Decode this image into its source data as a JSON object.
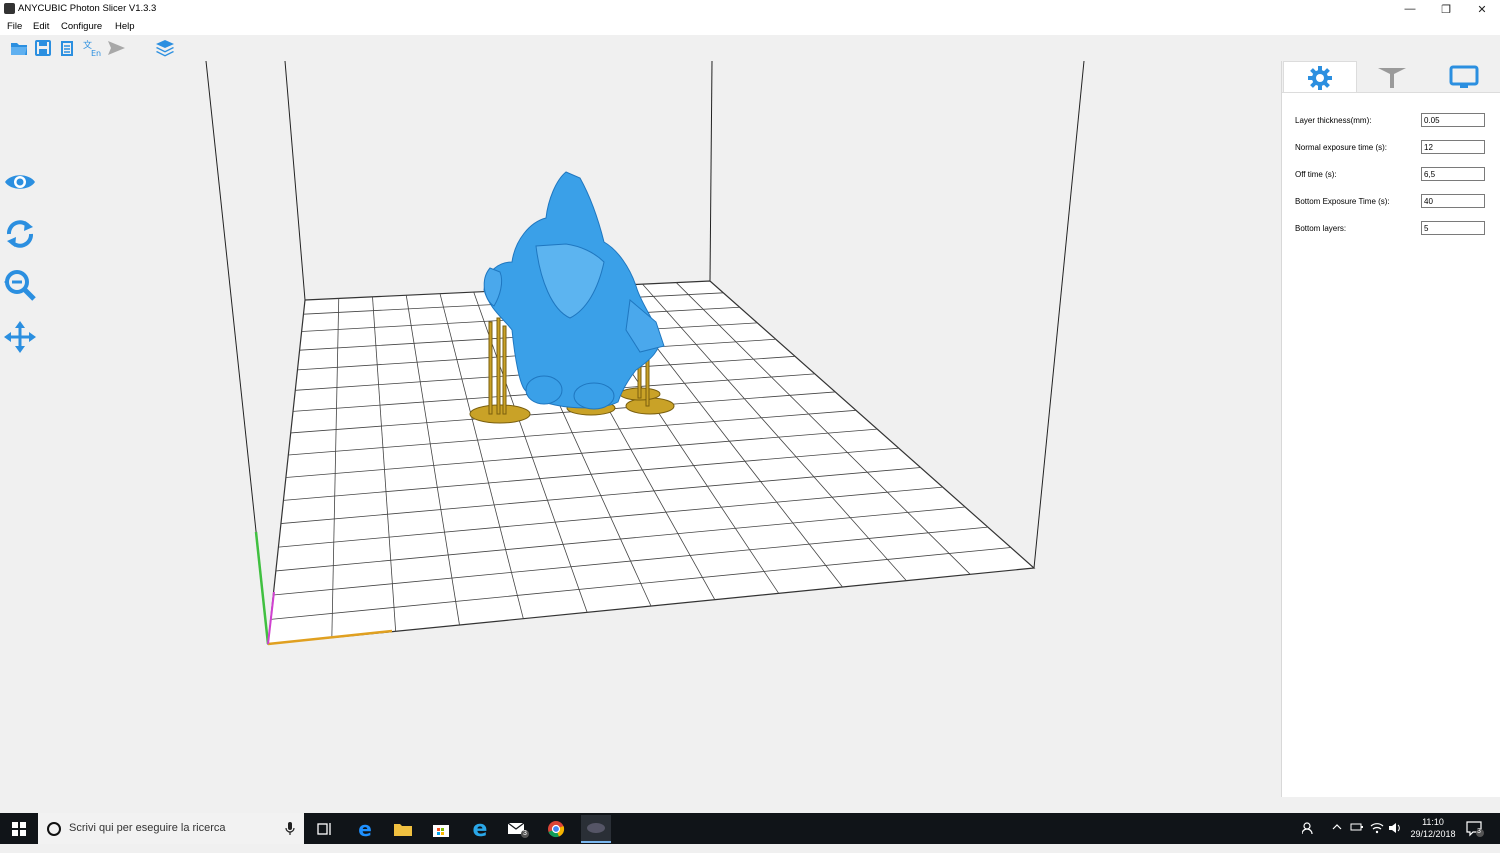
{
  "window": {
    "title": "ANYCUBIC Photon Slicer V1.3.3"
  },
  "menu": [
    "File",
    "Edit",
    "Configure",
    "Help"
  ],
  "toolbar": {
    "icons": [
      "open-folder-icon",
      "save-icon",
      "copy-icon",
      "language-icon",
      "send-icon",
      "layers-icon"
    ]
  },
  "sidebar": {
    "icons": [
      "eye-icon",
      "rotate-icon",
      "zoom-icon",
      "move-icon"
    ]
  },
  "panel": {
    "tabs": [
      "settings-gear-icon",
      "support-icon",
      "monitor-icon"
    ],
    "fields": [
      {
        "label": "Layer thickness(mm):",
        "value": "0.05"
      },
      {
        "label": "Normal exposure time (s):",
        "value": "12"
      },
      {
        "label": "Off time (s):",
        "value": "6,5"
      },
      {
        "label": "Bottom Exposure Time (s):",
        "value": "40"
      },
      {
        "label": "Bottom layers:",
        "value": "5"
      }
    ]
  },
  "taskbar": {
    "search_placeholder": "Scrivi qui per eseguire la ricerca",
    "time": "11:10",
    "date": "29/12/2018",
    "notification_count": "3",
    "mail_count": "3"
  },
  "colors": {
    "accent": "#2b8fe0",
    "model": "#3aa0e8",
    "supports": "#c9a227",
    "axis_x": "#e0a020",
    "axis_y": "#40c040",
    "axis_z": "#d040d0"
  }
}
